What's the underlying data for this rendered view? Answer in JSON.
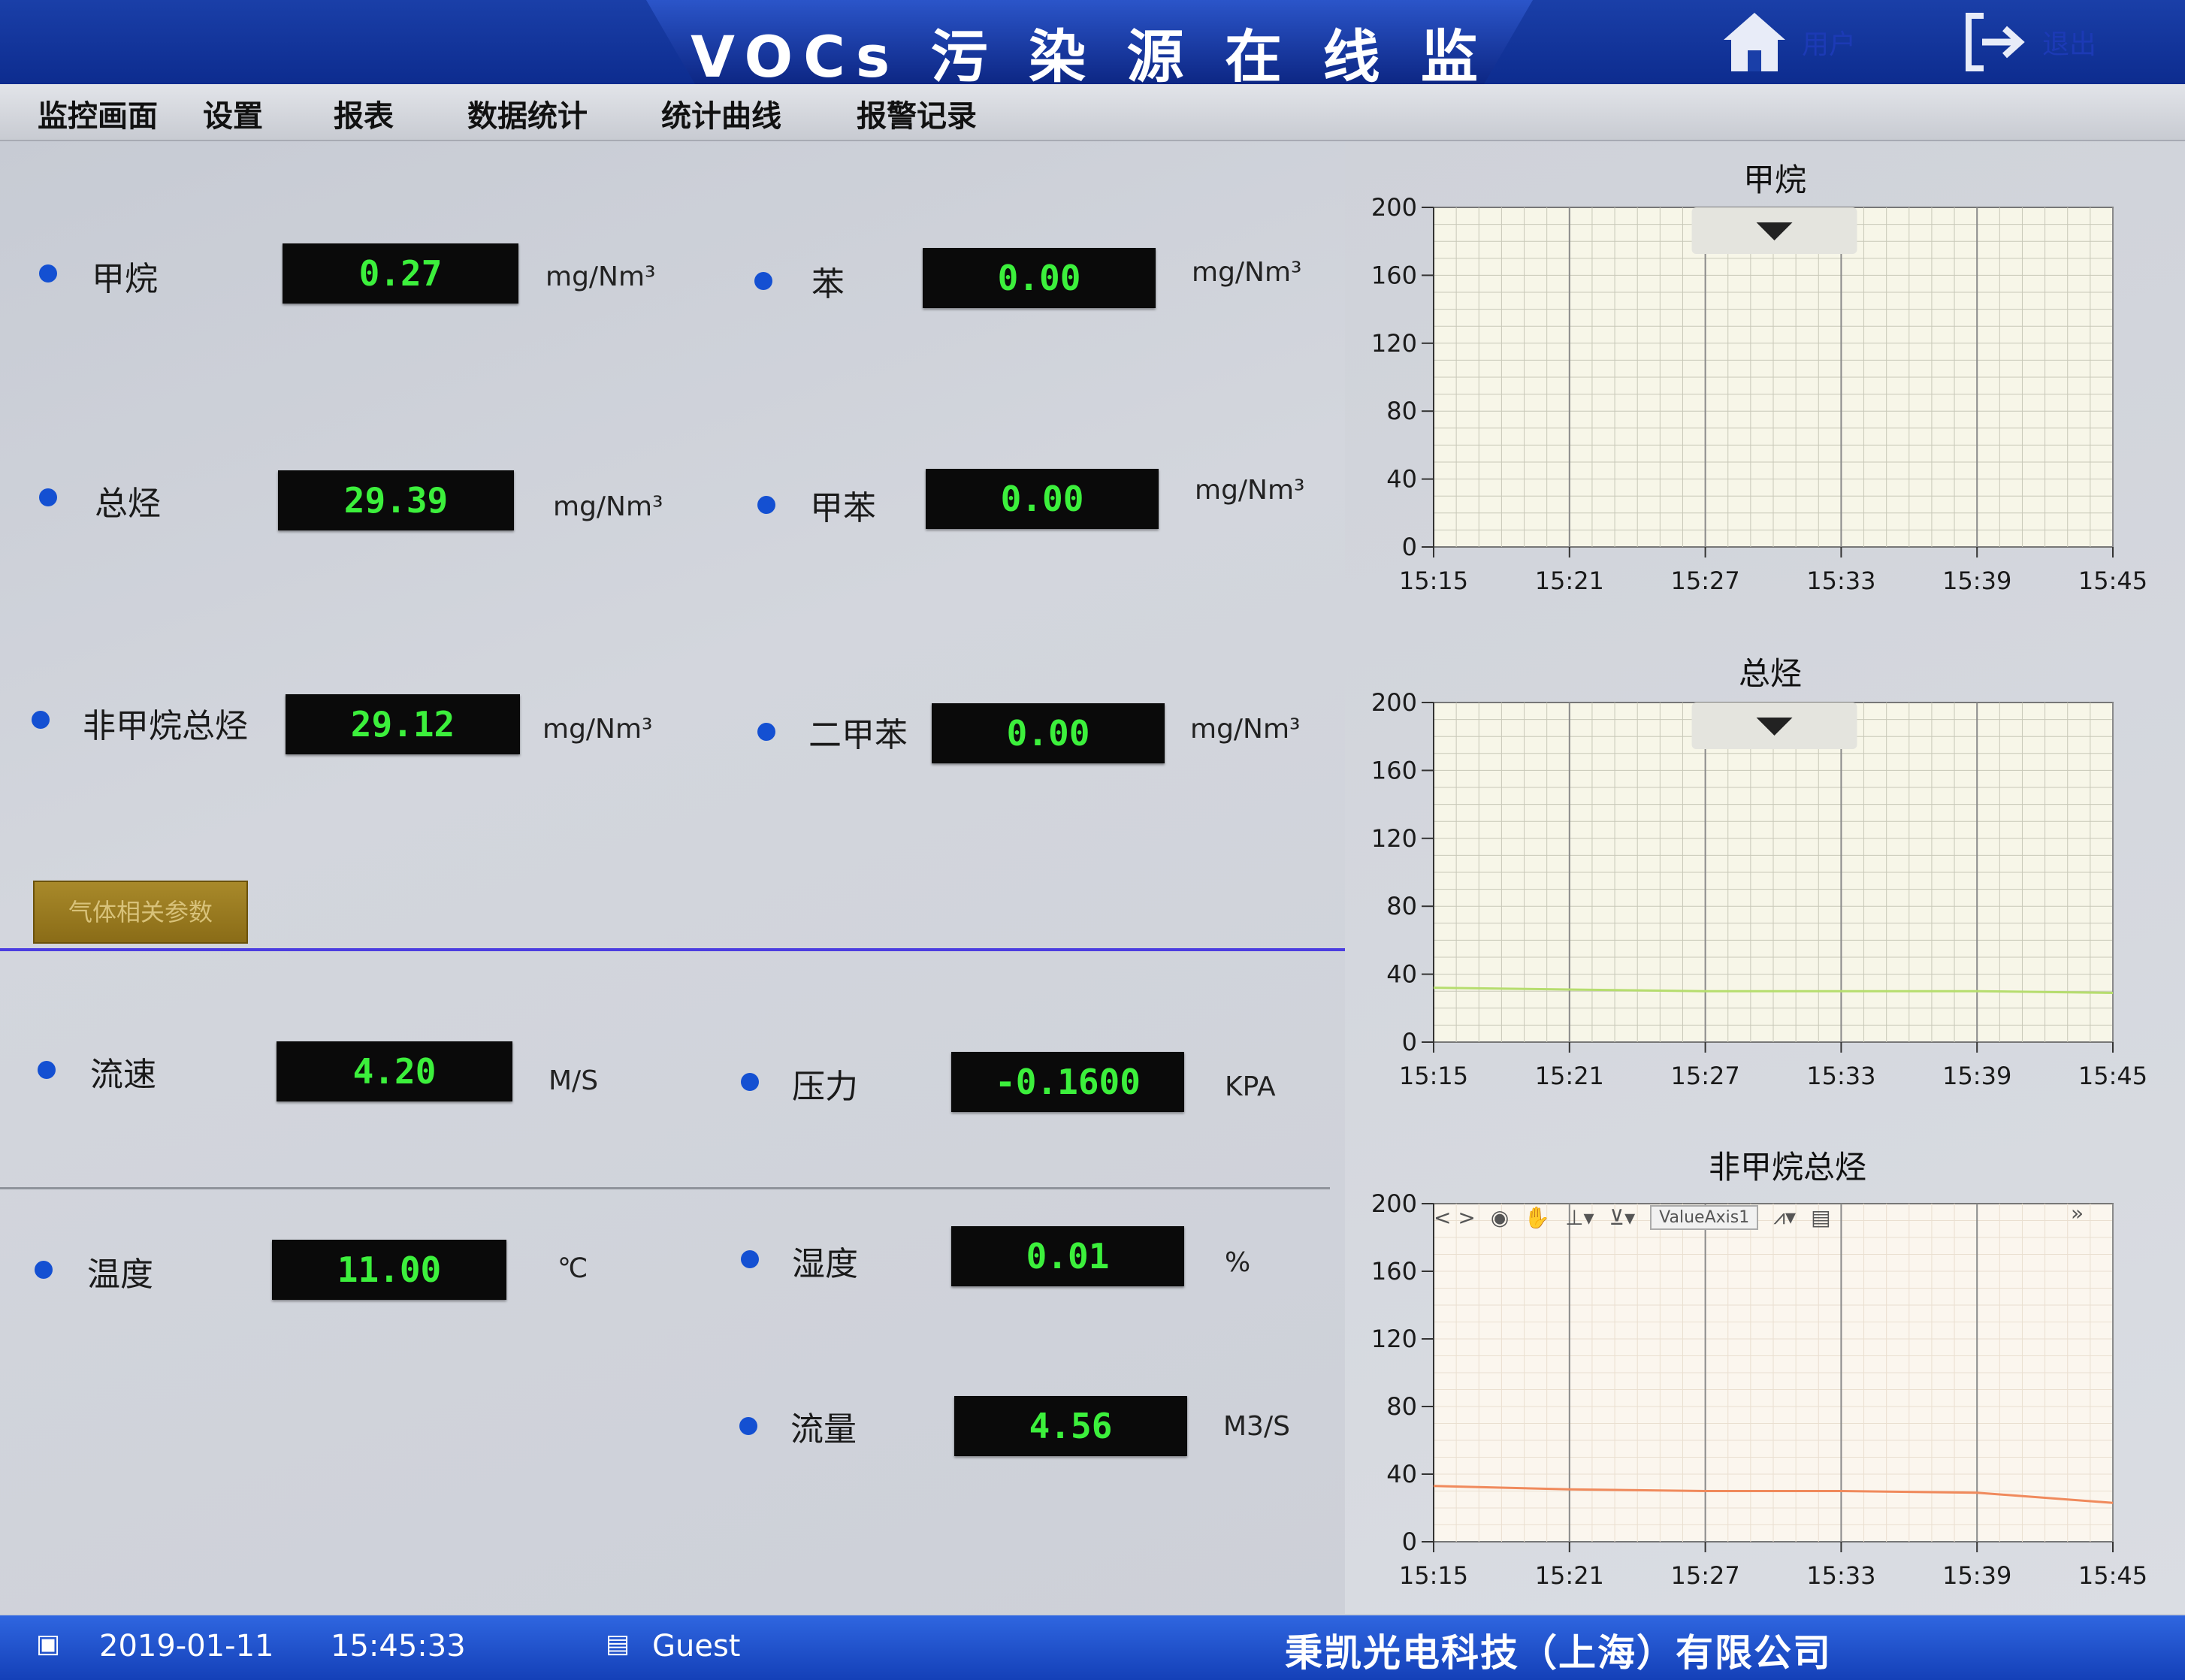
{
  "header": {
    "title": "VOCs 污 染 源 在 线 监 测 系 统",
    "home_label": "用户",
    "exit_label": "退出"
  },
  "menu": [
    "监控画面",
    "设置",
    "报表",
    "数据统计",
    "统计曲线",
    "报警记录"
  ],
  "gas_params": [
    {
      "label": "甲烷",
      "value": "0.27",
      "unit": "mg/Nm³"
    },
    {
      "label": "苯",
      "value": "0.00",
      "unit": "mg/Nm³"
    },
    {
      "label": "总烃",
      "value": "29.39",
      "unit": "mg/Nm³"
    },
    {
      "label": "甲苯",
      "value": "0.00",
      "unit": "mg/Nm³"
    },
    {
      "label": "非甲烷总烃",
      "value": "29.12",
      "unit": "mg/Nm³"
    },
    {
      "label": "二甲苯",
      "value": "0.00",
      "unit": "mg/Nm³"
    }
  ],
  "section_tag": "气体相关参数",
  "env_params": [
    {
      "label": "流速",
      "value": "4.20",
      "unit": "M/S"
    },
    {
      "label": "压力",
      "value": "-0.1600",
      "unit": "KPA"
    },
    {
      "label": "温度",
      "value": "11.00",
      "unit": "℃"
    },
    {
      "label": "湿度",
      "value": "0.01",
      "unit": "%"
    },
    {
      "label": "流量",
      "value": "4.56",
      "unit": "M3/S"
    }
  ],
  "chart_toolbar": {
    "axis_select": "ValueAxis1"
  },
  "chart_data": [
    {
      "type": "line",
      "title": "甲烷",
      "x": [
        "15:15",
        "15:21",
        "15:27",
        "15:33",
        "15:39",
        "15:45"
      ],
      "ylim": [
        0,
        200
      ],
      "yticks": [
        0,
        40,
        80,
        120,
        160,
        200
      ],
      "grid": true,
      "series": [],
      "line_color": "#9acd5a"
    },
    {
      "type": "line",
      "title": "总烃",
      "x": [
        "15:15",
        "15:21",
        "15:27",
        "15:33",
        "15:39",
        "15:45"
      ],
      "ylim": [
        0,
        200
      ],
      "yticks": [
        0,
        40,
        80,
        120,
        160,
        200
      ],
      "grid": true,
      "series": [
        {
          "values": [
            32,
            31,
            30,
            30,
            30,
            29
          ]
        }
      ],
      "line_color": "#b6dd6e"
    },
    {
      "type": "line",
      "title": "非甲烷总烃",
      "x": [
        "15:15",
        "15:21",
        "15:27",
        "15:33",
        "15:39",
        "15:45"
      ],
      "ylim": [
        0,
        200
      ],
      "yticks": [
        0,
        40,
        80,
        120,
        160,
        200
      ],
      "grid": true,
      "series": [
        {
          "values": [
            33,
            31,
            30,
            30,
            29,
            23
          ]
        }
      ],
      "line_color": "#f08a5c"
    }
  ],
  "status": {
    "date": "2019-01-11",
    "time": "15:45:33",
    "user": "Guest",
    "company": "秉凯光电科技（上海）有限公司"
  },
  "colors": {
    "header": "#1a3fa8",
    "value_text": "#3cf03c",
    "dot": "#1450d2",
    "status_bar": "#1f4fd0"
  }
}
